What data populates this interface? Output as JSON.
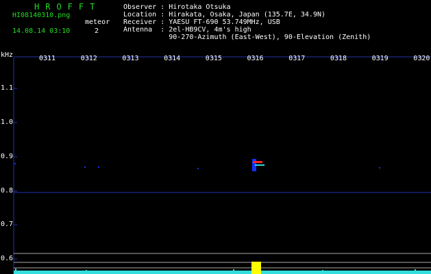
{
  "header": {
    "logo": "HROFFT",
    "filename": "HI08140310.png",
    "datetime": "14.08.14 03:10",
    "meteor_label": "meteor",
    "meteor_count": "2",
    "info": [
      {
        "key": "Observer",
        "value": "Hirotaka Otsuka"
      },
      {
        "key": "Location",
        "value": "Hirakata, Osaka, Japan (135.7E, 34.9N)"
      },
      {
        "key": "Receiver",
        "value": "YAESU FT-690 53.749MHz, USB"
      },
      {
        "key": "Antenna ",
        "value": "2el-HB9CV, 4m's high"
      },
      {
        "key": "",
        "value": "90-270-Azimuth (East-West), 90-Elevation (Zenith)"
      }
    ]
  },
  "axes": {
    "y_unit": "kHz",
    "y_ticks": [
      "1.1",
      "1.0",
      "0.9",
      "0.8",
      "0.7",
      "0.6"
    ],
    "x_ticks": [
      "0311",
      "0312",
      "0313",
      "0314",
      "0315",
      "0316",
      "0317",
      "0318",
      "0319",
      "0320"
    ]
  },
  "colors": {
    "background": "#000000",
    "text": "#ffffff",
    "accent": "#22dd22",
    "axis_frame": "#2233aa",
    "signal_echo": "#ff2222",
    "signal_blue": "#1133ff",
    "spectrum_cyan": "#33dddd",
    "spectrum_yellow": "#ffff00"
  }
}
